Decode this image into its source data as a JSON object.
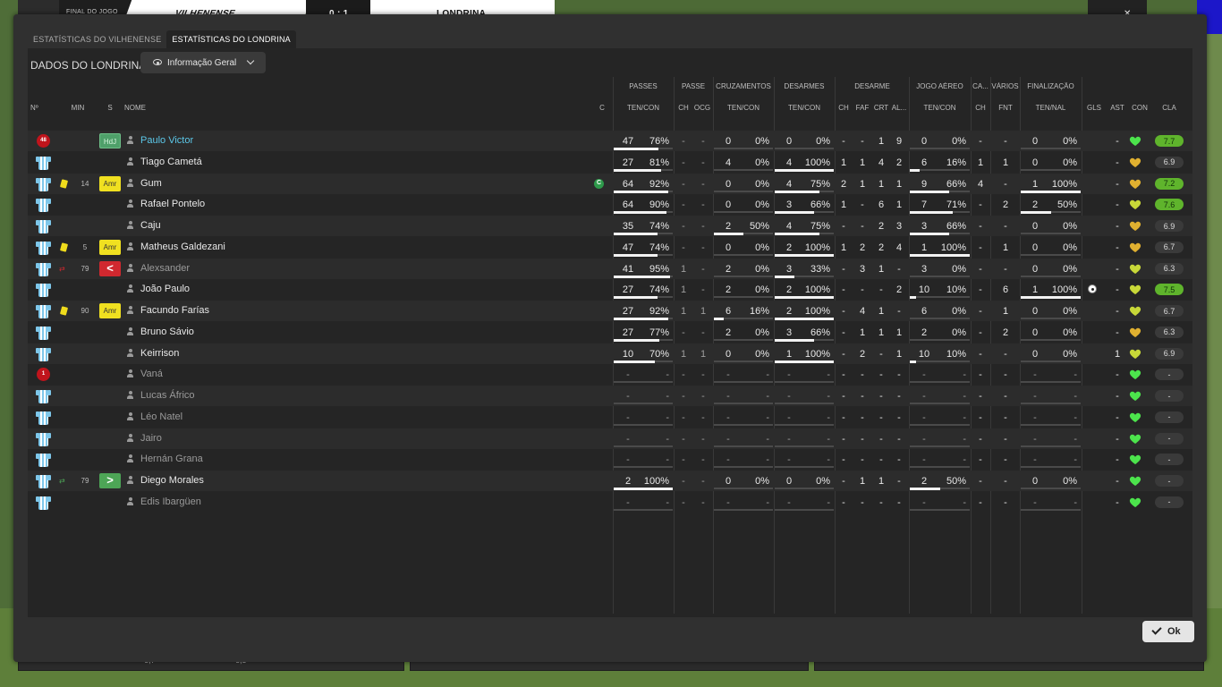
{
  "topbar": {
    "status": "FINAL DO JOGO",
    "home_team": "VILHENENSE",
    "score": "0 : 1",
    "away_team": "LONDRINA",
    "right_btn": "x",
    "close": "✕"
  },
  "tabs": [
    "ESTATÍSTICAS DO VILHENENSE",
    "ESTATÍSTICAS DO LONDRINA"
  ],
  "active_tab": 1,
  "panel_title": "DADOS DO LONDRINA",
  "view_select": {
    "value": "Informação Geral"
  },
  "group_headers": [
    "PASSES",
    "PASSE",
    "CRUZAMENTOS",
    "DESARMES",
    "DESARME",
    "JOGO AÉREO",
    "CA...",
    "VÁRIOS",
    "FINALIZAÇÃO"
  ],
  "columns": {
    "num": "Nº",
    "min": "MIN",
    "s": "S",
    "name": "NOME",
    "c": "C",
    "passes": "TEN/CON",
    "passe_ch": "CH",
    "passe_ocg": "OCG",
    "cruz": "TEN/CON",
    "desarmes": "TEN/CON",
    "des_ch": "CH",
    "des_faf": "FAF",
    "des_crt": "CRT",
    "des_al": "AL...",
    "aereo": "TEN/CON",
    "ca_ch": "CH",
    "varios_fnt": "FNT",
    "final": "TEN/NAL",
    "gls": "GLS",
    "ast": "AST",
    "con": "CON",
    "cla": "CLA"
  },
  "colors": {
    "heart_green": "#4ce44c",
    "heart_gold": "#e0b030",
    "heart_yellowgreen": "#c8d838",
    "accent_link": "#5cc8e9"
  },
  "players": [
    {
      "num": "48",
      "shirt": "gk",
      "card": "",
      "min": "",
      "sub": "",
      "pos": "HdJ",
      "pos_style": "hdj",
      "name": "Paulo Victor",
      "name_style": "link",
      "cap": false,
      "passes": [
        "47",
        "76%"
      ],
      "pfrac": 0.76,
      "ch": "-",
      "ocg": "-",
      "cruz": [
        "0",
        "0%"
      ],
      "cfrac": 0,
      "des": [
        "0",
        "0%"
      ],
      "dfrac": 0,
      "d_ch": "-",
      "faf": "-",
      "crt": "1",
      "al": "9",
      "aer": [
        "0",
        "0%"
      ],
      "afrac": 0,
      "ca": "-",
      "fnt": "-",
      "fin": [
        "0",
        "0%"
      ],
      "ffrac": 0,
      "gls": "",
      "ast": "-",
      "heart": "green",
      "rating": "7.7",
      "rate_style": "good"
    },
    {
      "num": "",
      "shirt": "std",
      "card": "",
      "min": "",
      "sub": "",
      "pos": "",
      "pos_style": "",
      "name": "Tiago Cametá",
      "name_style": "",
      "cap": false,
      "passes": [
        "27",
        "81%"
      ],
      "pfrac": 0.81,
      "ch": "-",
      "ocg": "-",
      "cruz": [
        "4",
        "0%"
      ],
      "cfrac": 0,
      "des": [
        "4",
        "100%"
      ],
      "dfrac": 1,
      "d_ch": "1",
      "faf": "1",
      "crt": "4",
      "al": "2",
      "aer": [
        "6",
        "16%"
      ],
      "afrac": 0.16,
      "ca": "1",
      "fnt": "1",
      "fin": [
        "0",
        "0%"
      ],
      "ffrac": 0,
      "gls": "",
      "ast": "-",
      "heart": "gold",
      "rating": "6.9",
      "rate_style": ""
    },
    {
      "num": "",
      "shirt": "std",
      "card": "yellow",
      "min": "14",
      "sub": "",
      "pos": "Amr",
      "pos_style": "amr",
      "name": "Gum",
      "name_style": "",
      "cap": true,
      "passes": [
        "64",
        "92%"
      ],
      "pfrac": 0.92,
      "ch": "-",
      "ocg": "-",
      "cruz": [
        "0",
        "0%"
      ],
      "cfrac": 0,
      "des": [
        "4",
        "75%"
      ],
      "dfrac": 0.75,
      "d_ch": "2",
      "faf": "1",
      "crt": "1",
      "al": "1",
      "aer": [
        "9",
        "66%"
      ],
      "afrac": 0.66,
      "ca": "4",
      "fnt": "-",
      "fin": [
        "1",
        "100%"
      ],
      "ffrac": 1,
      "gls": "",
      "ast": "-",
      "heart": "gold",
      "rating": "7.2",
      "rate_style": "good"
    },
    {
      "num": "",
      "shirt": "std",
      "card": "",
      "min": "",
      "sub": "",
      "pos": "",
      "pos_style": "",
      "name": "Rafael Pontelo",
      "name_style": "",
      "cap": false,
      "passes": [
        "64",
        "90%"
      ],
      "pfrac": 0.9,
      "ch": "-",
      "ocg": "-",
      "cruz": [
        "0",
        "0%"
      ],
      "cfrac": 0,
      "des": [
        "3",
        "66%"
      ],
      "dfrac": 0.66,
      "d_ch": "1",
      "faf": "-",
      "crt": "6",
      "al": "1",
      "aer": [
        "7",
        "71%"
      ],
      "afrac": 0.71,
      "ca": "-",
      "fnt": "2",
      "fin": [
        "2",
        "50%"
      ],
      "ffrac": 0.5,
      "gls": "",
      "ast": "-",
      "heart": "yellowgreen",
      "rating": "7.6",
      "rate_style": "good"
    },
    {
      "num": "",
      "shirt": "std",
      "card": "",
      "min": "",
      "sub": "",
      "pos": "",
      "pos_style": "",
      "name": "Caju",
      "name_style": "",
      "cap": false,
      "passes": [
        "35",
        "74%"
      ],
      "pfrac": 0.74,
      "ch": "-",
      "ocg": "-",
      "cruz": [
        "2",
        "50%"
      ],
      "cfrac": 0.5,
      "des": [
        "4",
        "75%"
      ],
      "dfrac": 0.75,
      "d_ch": "-",
      "faf": "-",
      "crt": "2",
      "al": "3",
      "aer": [
        "3",
        "66%"
      ],
      "afrac": 0.66,
      "ca": "-",
      "fnt": "-",
      "fin": [
        "0",
        "0%"
      ],
      "ffrac": 0,
      "gls": "",
      "ast": "-",
      "heart": "gold",
      "rating": "6.9",
      "rate_style": ""
    },
    {
      "num": "",
      "shirt": "std",
      "card": "yellow",
      "min": "5",
      "sub": "",
      "pos": "Amr",
      "pos_style": "amr",
      "name": "Matheus Galdezani",
      "name_style": "",
      "cap": false,
      "passes": [
        "47",
        "74%"
      ],
      "pfrac": 0.74,
      "ch": "-",
      "ocg": "-",
      "cruz": [
        "0",
        "0%"
      ],
      "cfrac": 0,
      "des": [
        "2",
        "100%"
      ],
      "dfrac": 1,
      "d_ch": "1",
      "faf": "2",
      "crt": "2",
      "al": "4",
      "aer": [
        "1",
        "100%"
      ],
      "afrac": 1,
      "ca": "-",
      "fnt": "1",
      "fin": [
        "0",
        "0%"
      ],
      "ffrac": 0,
      "gls": "",
      "ast": "-",
      "heart": "gold",
      "rating": "6.7",
      "rate_style": ""
    },
    {
      "num": "",
      "shirt": "std",
      "card": "",
      "min": "79",
      "sub": "out",
      "pos": "<",
      "pos_style": "out",
      "name": "Alexsander",
      "name_style": "muted",
      "cap": false,
      "passes": [
        "41",
        "95%"
      ],
      "pfrac": 0.95,
      "ch": "1",
      "ocg": "-",
      "cruz": [
        "2",
        "0%"
      ],
      "cfrac": 0,
      "des": [
        "3",
        "33%"
      ],
      "dfrac": 0.33,
      "d_ch": "-",
      "faf": "3",
      "crt": "1",
      "al": "-",
      "aer": [
        "3",
        "0%"
      ],
      "afrac": 0,
      "ca": "-",
      "fnt": "-",
      "fin": [
        "0",
        "0%"
      ],
      "ffrac": 0,
      "gls": "",
      "ast": "-",
      "heart": "yellowgreen",
      "rating": "6.3",
      "rate_style": ""
    },
    {
      "num": "",
      "shirt": "std",
      "card": "",
      "min": "",
      "sub": "",
      "pos": "",
      "pos_style": "",
      "name": "João Paulo",
      "name_style": "",
      "cap": false,
      "passes": [
        "27",
        "74%"
      ],
      "pfrac": 0.74,
      "ch": "1",
      "ocg": "-",
      "cruz": [
        "2",
        "0%"
      ],
      "cfrac": 0,
      "des": [
        "2",
        "100%"
      ],
      "dfrac": 1,
      "d_ch": "-",
      "faf": "-",
      "crt": "-",
      "al": "2",
      "aer": [
        "10",
        "10%"
      ],
      "afrac": 0.1,
      "ca": "-",
      "fnt": "6",
      "fin": [
        "1",
        "100%"
      ],
      "ffrac": 1,
      "gls": "ball",
      "ast": "-",
      "heart": "yellowgreen",
      "rating": "7.5",
      "rate_style": "good"
    },
    {
      "num": "",
      "shirt": "std",
      "card": "yellow",
      "min": "90",
      "sub": "",
      "pos": "Amr",
      "pos_style": "amr",
      "name": "Facundo Farías",
      "name_style": "",
      "cap": false,
      "passes": [
        "27",
        "92%"
      ],
      "pfrac": 0.92,
      "ch": "1",
      "ocg": "1",
      "cruz": [
        "6",
        "16%"
      ],
      "cfrac": 0.16,
      "des": [
        "2",
        "100%"
      ],
      "dfrac": 1,
      "d_ch": "-",
      "faf": "4",
      "crt": "1",
      "al": "-",
      "aer": [
        "6",
        "0%"
      ],
      "afrac": 0,
      "ca": "-",
      "fnt": "1",
      "fin": [
        "0",
        "0%"
      ],
      "ffrac": 0,
      "gls": "",
      "ast": "-",
      "heart": "yellowgreen",
      "rating": "6.7",
      "rate_style": ""
    },
    {
      "num": "",
      "shirt": "std",
      "card": "",
      "min": "",
      "sub": "",
      "pos": "",
      "pos_style": "",
      "name": "Bruno Sávio",
      "name_style": "",
      "cap": false,
      "passes": [
        "27",
        "77%"
      ],
      "pfrac": 0.77,
      "ch": "-",
      "ocg": "-",
      "cruz": [
        "2",
        "0%"
      ],
      "cfrac": 0,
      "des": [
        "3",
        "66%"
      ],
      "dfrac": 0.66,
      "d_ch": "-",
      "faf": "1",
      "crt": "1",
      "al": "1",
      "aer": [
        "2",
        "0%"
      ],
      "afrac": 0,
      "ca": "-",
      "fnt": "2",
      "fin": [
        "0",
        "0%"
      ],
      "ffrac": 0,
      "gls": "",
      "ast": "-",
      "heart": "gold",
      "rating": "6.3",
      "rate_style": ""
    },
    {
      "num": "",
      "shirt": "std",
      "card": "",
      "min": "",
      "sub": "",
      "pos": "",
      "pos_style": "",
      "name": "Keirrison",
      "name_style": "",
      "cap": false,
      "passes": [
        "10",
        "70%"
      ],
      "pfrac": 0.7,
      "ch": "1",
      "ocg": "1",
      "cruz": [
        "0",
        "0%"
      ],
      "cfrac": 0,
      "des": [
        "1",
        "100%"
      ],
      "dfrac": 1,
      "d_ch": "-",
      "faf": "2",
      "crt": "-",
      "al": "1",
      "aer": [
        "10",
        "10%"
      ],
      "afrac": 0.1,
      "ca": "-",
      "fnt": "-",
      "fin": [
        "0",
        "0%"
      ],
      "ffrac": 0,
      "gls": "",
      "ast": "1",
      "heart": "yellowgreen",
      "rating": "6.9",
      "rate_style": ""
    },
    {
      "num": "1",
      "shirt": "gk",
      "card": "",
      "min": "",
      "sub": "",
      "pos": "",
      "pos_style": "",
      "name": "Vaná",
      "name_style": "muted",
      "cap": false,
      "passes": [
        "-",
        "-"
      ],
      "pfrac": null,
      "ch": "-",
      "ocg": "-",
      "cruz": [
        "-",
        "-"
      ],
      "cfrac": null,
      "des": [
        "-",
        "-"
      ],
      "dfrac": null,
      "d_ch": "-",
      "faf": "-",
      "crt": "-",
      "al": "-",
      "aer": [
        "-",
        "-"
      ],
      "afrac": null,
      "ca": "-",
      "fnt": "-",
      "fin": [
        "-",
        "-"
      ],
      "ffrac": null,
      "gls": "",
      "ast": "-",
      "heart": "green",
      "rating": "-",
      "rate_style": ""
    },
    {
      "num": "",
      "shirt": "std",
      "card": "",
      "min": "",
      "sub": "",
      "pos": "",
      "pos_style": "",
      "name": "Lucas Áfrico",
      "name_style": "muted",
      "cap": false,
      "passes": [
        "-",
        "-"
      ],
      "pfrac": null,
      "ch": "-",
      "ocg": "-",
      "cruz": [
        "-",
        "-"
      ],
      "cfrac": null,
      "des": [
        "-",
        "-"
      ],
      "dfrac": null,
      "d_ch": "-",
      "faf": "-",
      "crt": "-",
      "al": "-",
      "aer": [
        "-",
        "-"
      ],
      "afrac": null,
      "ca": "-",
      "fnt": "-",
      "fin": [
        "-",
        "-"
      ],
      "ffrac": null,
      "gls": "",
      "ast": "-",
      "heart": "green",
      "rating": "-",
      "rate_style": ""
    },
    {
      "num": "",
      "shirt": "std",
      "card": "",
      "min": "",
      "sub": "",
      "pos": "",
      "pos_style": "",
      "name": "Léo Natel",
      "name_style": "muted",
      "cap": false,
      "passes": [
        "-",
        "-"
      ],
      "pfrac": null,
      "ch": "-",
      "ocg": "-",
      "cruz": [
        "-",
        "-"
      ],
      "cfrac": null,
      "des": [
        "-",
        "-"
      ],
      "dfrac": null,
      "d_ch": "-",
      "faf": "-",
      "crt": "-",
      "al": "-",
      "aer": [
        "-",
        "-"
      ],
      "afrac": null,
      "ca": "-",
      "fnt": "-",
      "fin": [
        "-",
        "-"
      ],
      "ffrac": null,
      "gls": "",
      "ast": "-",
      "heart": "green",
      "rating": "-",
      "rate_style": ""
    },
    {
      "num": "",
      "shirt": "std",
      "card": "",
      "min": "",
      "sub": "",
      "pos": "",
      "pos_style": "",
      "name": "Jairo",
      "name_style": "muted",
      "cap": false,
      "passes": [
        "-",
        "-"
      ],
      "pfrac": null,
      "ch": "-",
      "ocg": "-",
      "cruz": [
        "-",
        "-"
      ],
      "cfrac": null,
      "des": [
        "-",
        "-"
      ],
      "dfrac": null,
      "d_ch": "-",
      "faf": "-",
      "crt": "-",
      "al": "-",
      "aer": [
        "-",
        "-"
      ],
      "afrac": null,
      "ca": "-",
      "fnt": "-",
      "fin": [
        "-",
        "-"
      ],
      "ffrac": null,
      "gls": "",
      "ast": "-",
      "heart": "green",
      "rating": "-",
      "rate_style": ""
    },
    {
      "num": "",
      "shirt": "std",
      "card": "",
      "min": "",
      "sub": "",
      "pos": "",
      "pos_style": "",
      "name": "Hernán Grana",
      "name_style": "muted",
      "cap": false,
      "passes": [
        "-",
        "-"
      ],
      "pfrac": null,
      "ch": "-",
      "ocg": "-",
      "cruz": [
        "-",
        "-"
      ],
      "cfrac": null,
      "des": [
        "-",
        "-"
      ],
      "dfrac": null,
      "d_ch": "-",
      "faf": "-",
      "crt": "-",
      "al": "-",
      "aer": [
        "-",
        "-"
      ],
      "afrac": null,
      "ca": "-",
      "fnt": "-",
      "fin": [
        "-",
        "-"
      ],
      "ffrac": null,
      "gls": "",
      "ast": "-",
      "heart": "green",
      "rating": "-",
      "rate_style": ""
    },
    {
      "num": "",
      "shirt": "std",
      "card": "",
      "min": "79",
      "sub": "in",
      "pos": ">",
      "pos_style": "in",
      "name": "Diego Morales",
      "name_style": "",
      "cap": false,
      "passes": [
        "2",
        "100%"
      ],
      "pfrac": 1,
      "ch": "-",
      "ocg": "-",
      "cruz": [
        "0",
        "0%"
      ],
      "cfrac": 0,
      "des": [
        "0",
        "0%"
      ],
      "dfrac": 0,
      "d_ch": "-",
      "faf": "1",
      "crt": "1",
      "al": "-",
      "aer": [
        "2",
        "50%"
      ],
      "afrac": 0.5,
      "ca": "-",
      "fnt": "-",
      "fin": [
        "0",
        "0%"
      ],
      "ffrac": 0,
      "gls": "",
      "ast": "-",
      "heart": "green",
      "rating": "-",
      "rate_style": ""
    },
    {
      "num": "",
      "shirt": "std",
      "card": "",
      "min": "",
      "sub": "",
      "pos": "",
      "pos_style": "",
      "name": "Edis Ibargüen",
      "name_style": "muted",
      "cap": false,
      "passes": [
        "-",
        "-"
      ],
      "pfrac": null,
      "ch": "-",
      "ocg": "-",
      "cruz": [
        "-",
        "-"
      ],
      "cfrac": null,
      "des": [
        "-",
        "-"
      ],
      "dfrac": null,
      "d_ch": "-",
      "faf": "-",
      "crt": "-",
      "al": "-",
      "aer": [
        "-",
        "-"
      ],
      "afrac": null,
      "ca": "-",
      "fnt": "-",
      "fin": [
        "-",
        "-"
      ],
      "ffrac": null,
      "gls": "",
      "ast": "-",
      "heart": "green",
      "rating": "-",
      "rate_style": ""
    }
  ],
  "ok_button": "Ok",
  "background_panels": {
    "rating_a": "6,7",
    "rating_b": "6,5"
  }
}
